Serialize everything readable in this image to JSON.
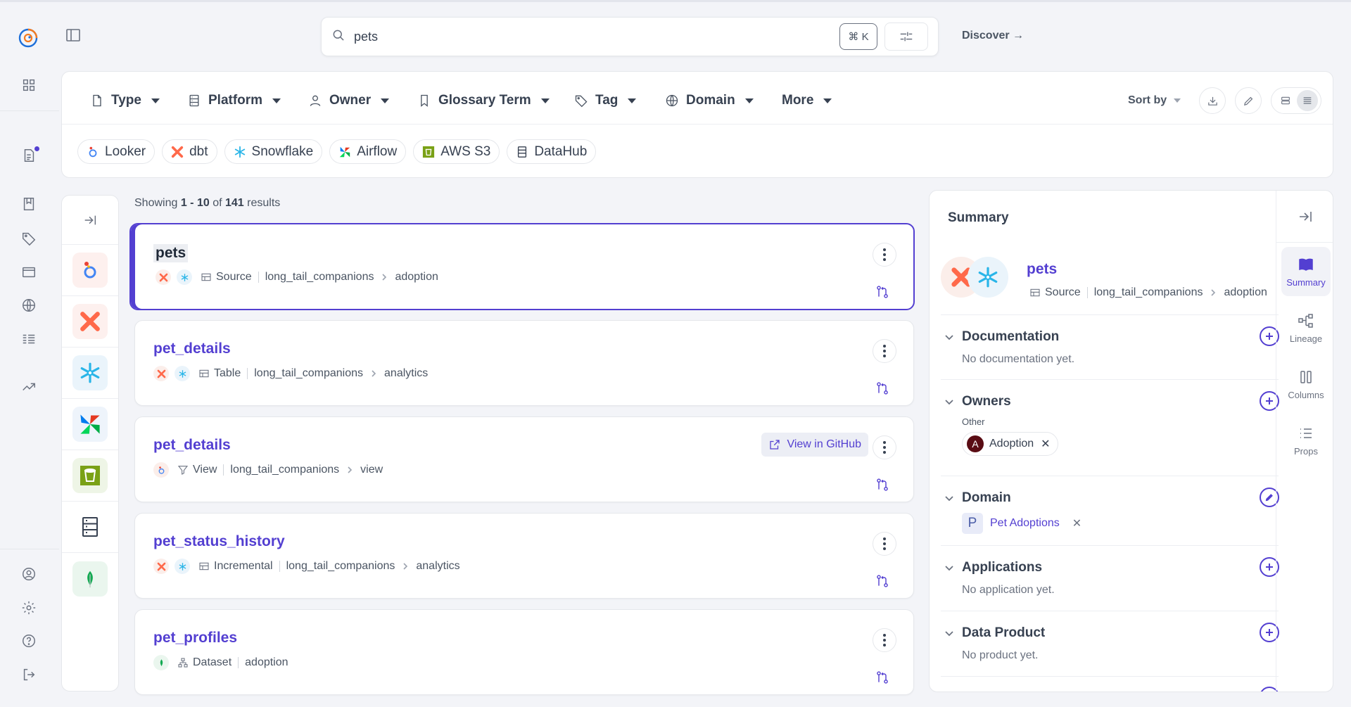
{
  "search": {
    "value": "pets",
    "shortcut": "⌘ K"
  },
  "header": {
    "discover": "Discover →"
  },
  "filters": {
    "dropdowns": [
      "Type",
      "Platform",
      "Owner",
      "Glossary Term",
      "Tag",
      "Domain",
      "More"
    ],
    "sort_label": "Sort by",
    "chips": [
      "Looker",
      "dbt",
      "Snowflake",
      "Airflow",
      "AWS S3",
      "DataHub"
    ]
  },
  "results": {
    "showing_prefix": "Showing",
    "range": "1 - 10",
    "of": "of",
    "total": "141",
    "suffix": "results",
    "items": [
      {
        "title": "pets",
        "type": "Source",
        "path1": "long_tail_companions",
        "path2": "adoption"
      },
      {
        "title": "pet_details",
        "type": "Table",
        "path1": "long_tail_companions",
        "path2": "analytics"
      },
      {
        "title": "pet_details",
        "type": "View",
        "path1": "long_tail_companions",
        "path2": "view",
        "action": "View in GitHub"
      },
      {
        "title": "pet_status_history",
        "type": "Incremental",
        "path1": "long_tail_companions",
        "path2": "analytics"
      },
      {
        "title": "pet_profiles",
        "type": "Dataset",
        "path1": "adoption"
      }
    ]
  },
  "summary": {
    "title": "Summary",
    "entity": {
      "name": "pets",
      "type": "Source",
      "path1": "long_tail_companions",
      "path2": "adoption"
    },
    "sections": {
      "documentation": {
        "label": "Documentation",
        "empty": "No documentation yet."
      },
      "owners": {
        "label": "Owners",
        "group": "Other",
        "owner": "Adoption",
        "avatar": "A"
      },
      "domain": {
        "label": "Domain",
        "letter": "P",
        "value": "Pet Adoptions"
      },
      "applications": {
        "label": "Applications",
        "empty": "No application yet."
      },
      "data_product": {
        "label": "Data Product",
        "empty": "No product yet."
      }
    },
    "tabs": [
      "Summary",
      "Lineage",
      "Columns",
      "Props"
    ]
  },
  "colors": {
    "accent": "#533fd1",
    "dbt": "#ff694a",
    "snowflake": "#29b5e8"
  }
}
